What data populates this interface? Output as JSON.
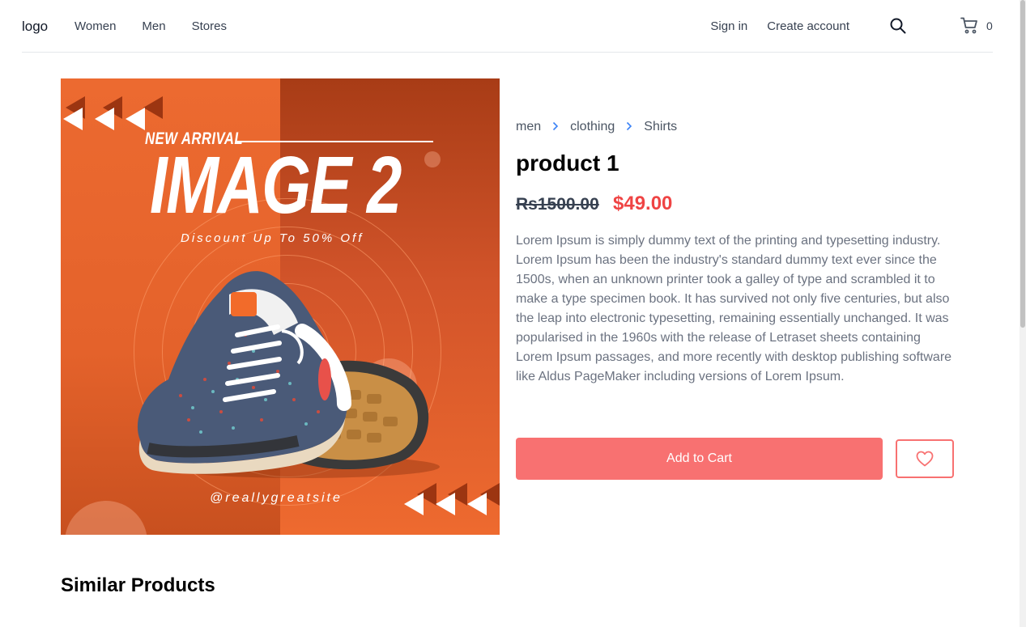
{
  "header": {
    "logo": "logo",
    "nav": [
      "Women",
      "Men",
      "Stores"
    ],
    "sign_in": "Sign in",
    "create_account": "Create account",
    "cart_count": "0"
  },
  "hero": {
    "new_arrival": "NEW ARRIVAL",
    "title": "IMAGE 2",
    "discount": "Discount Up To 50% Off",
    "handle": "@reallygreatsite"
  },
  "breadcrumb": [
    "men",
    "clothing",
    "Shirts"
  ],
  "product": {
    "title": "product 1",
    "old_price": "Rs1500.00",
    "new_price": "$49.00",
    "description": "Lorem Ipsum is simply dummy text of the printing and typesetting industry. Lorem Ipsum has been the industry's standard dummy text ever since the 1500s, when an unknown printer took a galley of type and scrambled it to make a type specimen book. It has survived not only five centuries, but also the leap into electronic typesetting, remaining essentially unchanged. It was popularised in the 1960s with the release of Letraset sheets containing Lorem Ipsum passages, and more recently with desktop publishing software like Aldus PageMaker including versions of Lorem Ipsum.",
    "add_to_cart": "Add to Cart"
  },
  "similar_heading": "Similar Products",
  "icons": {
    "search": "search-icon",
    "cart": "cart-icon",
    "wishlist": "heart-icon",
    "breadcrumb_separator": "chevron-right-icon"
  },
  "colors": {
    "accent": "#f87171",
    "price": "#ef4444",
    "breadcrumb_separator": "#3b82f6"
  }
}
